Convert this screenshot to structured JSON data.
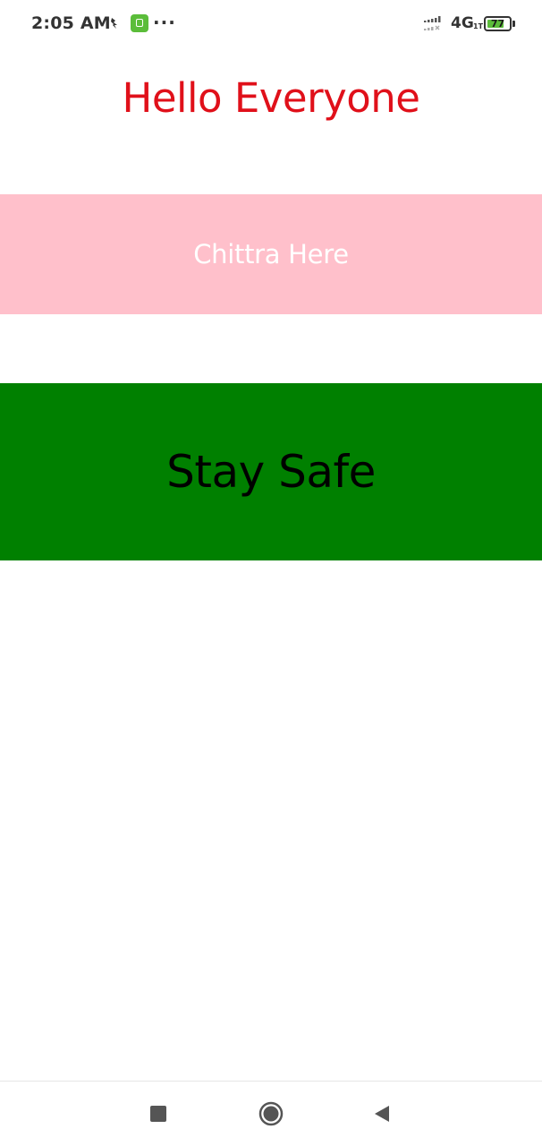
{
  "status_bar": {
    "time": "2:05 AM",
    "more_label": "···",
    "network": "4G",
    "network_sub": "1T",
    "battery_level": "77",
    "battery_percent": 77
  },
  "content": {
    "greeting": "Hello Everyone",
    "banner_text": "Chittra Here",
    "message": "Stay Safe"
  },
  "colors": {
    "greeting": "#e0101a",
    "banner_bg": "#ffc0cb",
    "banner_text": "#ffffff",
    "message_bg": "#008000",
    "message_text": "#000000"
  },
  "icons": {
    "status_app": "notification-app-icon",
    "status_chat": "chat-app-icon",
    "signal": "signal-strength-icon",
    "battery": "battery-icon",
    "nav_recents": "recents-square-icon",
    "nav_home": "home-circle-icon",
    "nav_back": "back-triangle-icon"
  }
}
